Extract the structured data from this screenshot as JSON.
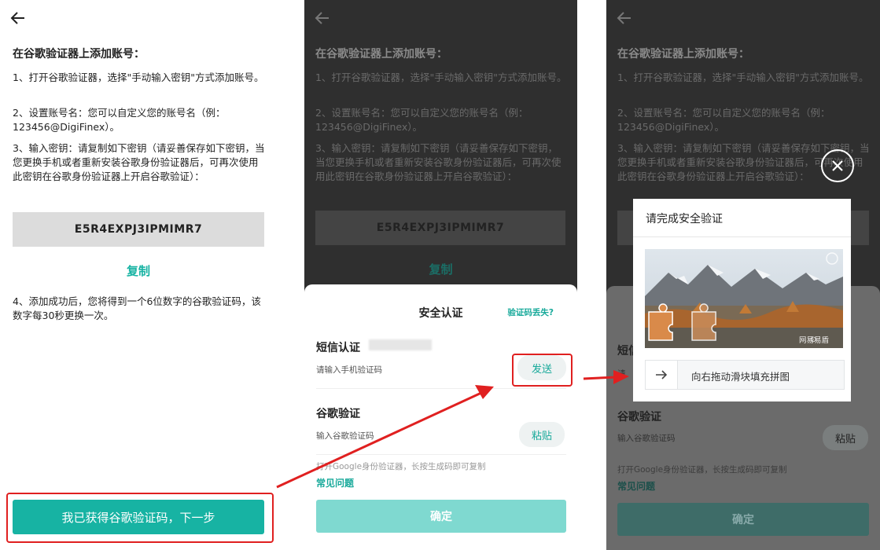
{
  "screen": {
    "title": "在谷歌验证器上添加账号：",
    "steps": [
      "1、打开谷歌验证器，选择\"手动输入密钥\"方式添加账号。",
      "2、设置账号名：您可以自定义您的账号名（例：123456@DigiFinex）。",
      "3、输入密钥：请复制如下密钥（请妥善保存如下密钥，当您更换手机或者重新安装谷歌身份验证器后，可再次使用此密钥在谷歌身份验证器上开启谷歌验证）：",
      "4、添加成功后，您将得到一个6位数字的谷歌验证码，该数字每30秒更换一次。"
    ],
    "secret_key": "E5R4EXPJ3IPMIMR7",
    "copy_label": "复制",
    "next_button": "我已获得谷歌验证码，下一步"
  },
  "security_sheet": {
    "title": "安全认证",
    "lost_code": "验证码丢失?",
    "sms_label": "短信认证",
    "sms_placeholder": "请输入手机验证码",
    "send_label": "发送",
    "google_label": "谷歌验证",
    "google_placeholder": "输入谷歌验证码",
    "paste_label": "粘贴",
    "hint": "打开Google身份验证器，长按生成码即可复制",
    "faq": "常见问题",
    "confirm": "确定"
  },
  "captcha": {
    "title": "请完成安全验证",
    "slider_text": "向右拖动滑块填充拼图",
    "brand": "网易易盾"
  },
  "panel3_partial": {
    "sms_label_partial": "短信",
    "sms_sub_partial": "请"
  },
  "colors": {
    "accent": "#17b3a3",
    "confirm_disabled": "#7fd9d0",
    "highlight": "#e02020"
  },
  "icons": [
    "back-arrow-icon",
    "close-icon",
    "slider-arrow-icon",
    "refresh-icon"
  ]
}
